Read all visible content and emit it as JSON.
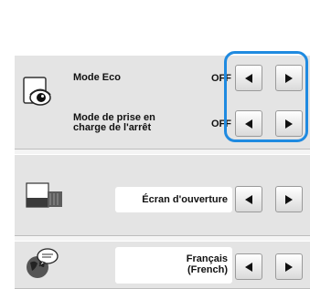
{
  "eco_row": {
    "label": "Mode Eco",
    "value": "OFF"
  },
  "shutoff_row": {
    "label_line1": "Mode de prise en",
    "label_line2": "charge de l'arrêt",
    "value": "OFF"
  },
  "opening_screen_row": {
    "value": "Écran d'ouverture"
  },
  "language_row": {
    "value_line1": "Français",
    "value_line2": "(French)"
  },
  "icons": {
    "eco": "eye-monitor-icon",
    "opening_screen": "machine-screen-icon",
    "language": "globe-speech-icon",
    "left": "left-arrow-icon",
    "right": "right-arrow-icon"
  },
  "colors": {
    "highlight": "#1f8ae0",
    "panel": "#e4e4e4"
  }
}
